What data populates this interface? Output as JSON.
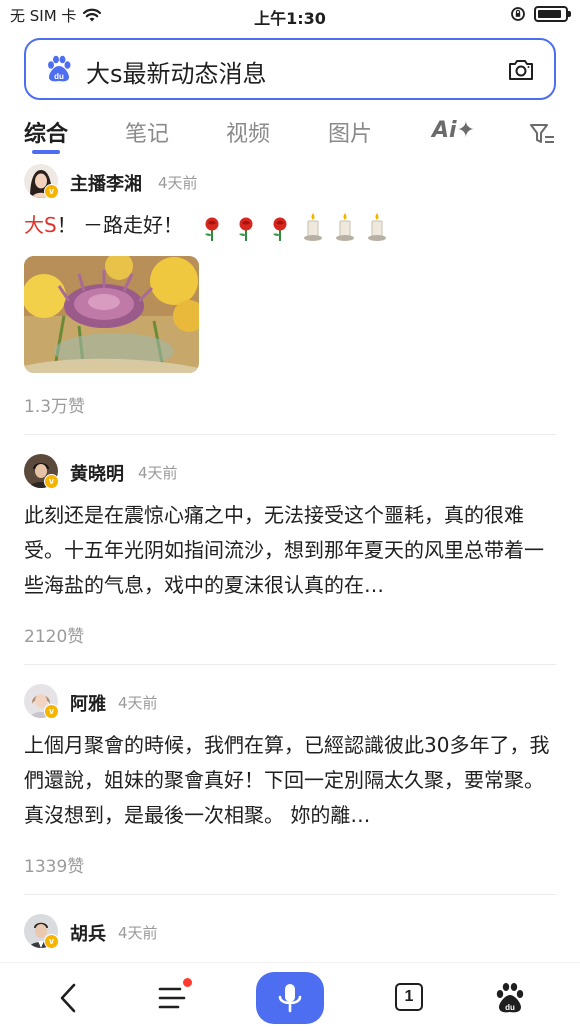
{
  "status_bar": {
    "carrier": "无 SIM 卡",
    "time": "上午1:30",
    "battery_level": 0.9
  },
  "search": {
    "query": "大s最新动态消息",
    "logo_text": "du"
  },
  "tabs": {
    "items": [
      "综合",
      "笔记",
      "视频",
      "图片"
    ],
    "active": "综合",
    "ai_label": "Ai✦"
  },
  "posts": [
    {
      "author": "主播李湘",
      "time": "4天前",
      "text_highlight": "大S",
      "text": "！ －路走好！",
      "emojis": [
        "rose",
        "rose",
        "rose",
        "candle",
        "candle",
        "candle"
      ],
      "likes": "1.3万赞"
    },
    {
      "author": "黄晓明",
      "time": "4天前",
      "text": "此刻还是在震惊心痛之中，无法接受这个噩耗，真的很难受。十五年光阴如指间流沙，想到那年夏天的风里总带着一些海盐的气息，戏中的夏沫很认真的在…",
      "likes": "2120赞"
    },
    {
      "author": "阿雅",
      "time": "4天前",
      "text": "上個月聚會的時候，我們在算，已經認識彼此30多年了，我們還說，姐妹的聚會真好！下回一定別隔太久聚，要常聚。真沒想到，是最後一次相聚。 妳的離…",
      "likes": "1339赞"
    },
    {
      "author": "胡兵",
      "time": "4天前"
    }
  ],
  "bottom_bar": {
    "tab_count": "1"
  },
  "colors": {
    "accent": "#4e6ef2",
    "highlight": "#e0332b",
    "badge": "#f5b400"
  }
}
